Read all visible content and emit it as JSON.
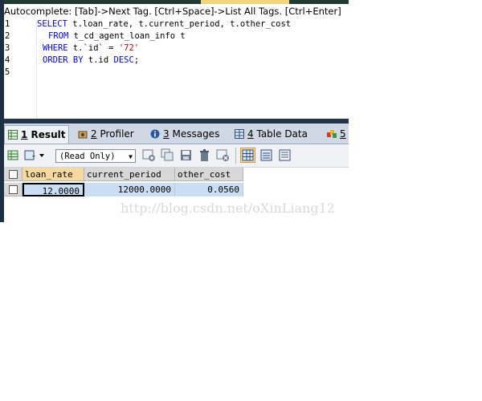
{
  "autocomplete_hint": "Autocomplete: [Tab]->Next Tag. [Ctrl+Space]->List All Tags. [Ctrl+Enter]",
  "editor": {
    "line_numbers": [
      "1",
      "2",
      "3",
      "4",
      "5"
    ],
    "lines": [
      {
        "kw": "SELECT",
        "rest": " t.loan_rate, t.current_period, t.other_cost"
      },
      {
        "kw": "FROM",
        "rest": " t_cd_agent_loan_info t"
      },
      {
        "kw": "WHERE",
        "rest_id": " t.`id` = ",
        "str": "'72'"
      },
      {
        "kw": "ORDER BY",
        "rest": " t.id ",
        "kw2": "DESC",
        "tail": ";"
      }
    ]
  },
  "tabs": [
    {
      "num": "1",
      "label": "Result",
      "icon": "result-grid-icon",
      "active": true
    },
    {
      "num": "2",
      "label": "Profiler",
      "icon": "profiler-icon",
      "active": false
    },
    {
      "num": "3",
      "label": "Messages",
      "icon": "info-icon",
      "active": false
    },
    {
      "num": "4",
      "label": "Table Data",
      "icon": "table-icon",
      "active": false
    },
    {
      "num": "5",
      "label": "",
      "icon": "colored-blocks-icon",
      "active": false
    }
  ],
  "toolbar": {
    "mode_select": "(Read Only)"
  },
  "result_grid": {
    "columns": [
      "loan_rate",
      "current_period",
      "other_cost"
    ],
    "rows": [
      [
        "12.0000",
        "12000.0000",
        "0.0560"
      ]
    ]
  },
  "watermark": "http://blog.csdn.net/oXinLiang12",
  "colors": {
    "keyword": "#0000ff",
    "string": "#cc0000",
    "selected_header": "#f7d9a0",
    "cell_fill": "#c9ddf3"
  }
}
